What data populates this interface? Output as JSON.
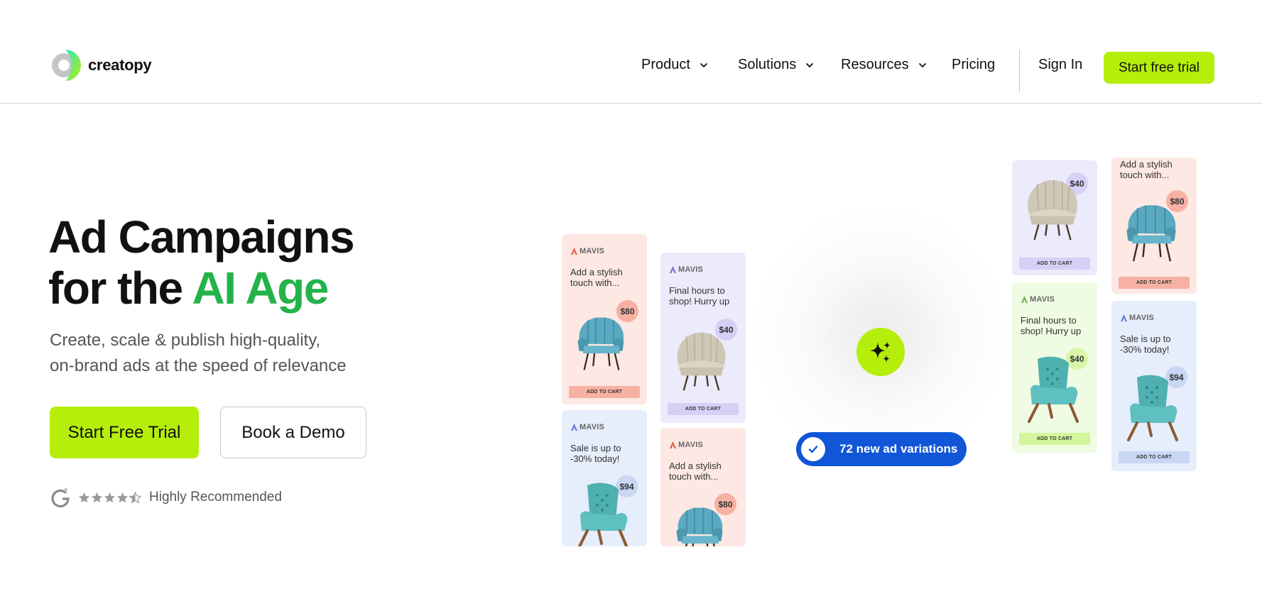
{
  "header": {
    "logo_text": "creatopy",
    "nav": [
      {
        "label": "Product",
        "has_dropdown": true
      },
      {
        "label": "Solutions",
        "has_dropdown": true
      },
      {
        "label": "Resources",
        "has_dropdown": true
      },
      {
        "label": "Pricing",
        "has_dropdown": false
      }
    ],
    "sign_in": "Sign In",
    "cta": "Start free trial"
  },
  "hero": {
    "title_line1": "Ad Campaigns",
    "title_line2_prefix": "for the ",
    "title_line2_highlight": "AI Age",
    "subtitle_line1": "Create, scale & publish high-quality,",
    "subtitle_line2": "on-brand ads at the speed of relevance",
    "primary_button": "Start Free Trial",
    "secondary_button": "Book a Demo",
    "rating": {
      "stars": 4.5,
      "max": 5,
      "label": "Highly Recommended",
      "badge_icon": "g2-icon"
    }
  },
  "graphic": {
    "pill_text": "72 new ad variations",
    "center_icon": "sparkles-icon",
    "cards": [
      {
        "brand": "MAVIS",
        "headline": "Add a stylish touch with...",
        "price": "$80",
        "cta": "ADD TO CART",
        "theme": "pink",
        "chair": "teal-shell-chair"
      },
      {
        "brand": "MAVIS",
        "headline": "Final hours to shop! Hurry up",
        "price": "$40",
        "cta": "ADD TO CART",
        "theme": "lavender",
        "chair": "beige-tub-chair"
      },
      {
        "brand": "MAVIS",
        "headline": "Sale is up to -30% today!",
        "price": "$94",
        "cta": "",
        "theme": "blue",
        "chair": "teal-lounge-chair"
      },
      {
        "brand": "MAVIS",
        "headline": "Add a stylish touch with...",
        "price": "$80",
        "cta": "",
        "theme": "pink",
        "chair": "teal-shell-chair"
      },
      {
        "brand": "",
        "headline": "",
        "price": "$40",
        "cta": "ADD TO CART",
        "theme": "lavender",
        "chair": "beige-tub-chair"
      },
      {
        "brand": "",
        "headline": "Add a stylish touch with...",
        "price": "$80",
        "cta": "ADD TO CART",
        "theme": "pink",
        "chair": "teal-shell-chair"
      },
      {
        "brand": "MAVIS",
        "headline": "Final hours to shop! Hurry up",
        "price": "$40",
        "cta": "ADD TO CART",
        "theme": "mint",
        "chair": "teal-lounge-chair"
      },
      {
        "brand": "MAVIS",
        "headline": "Sale is up to -30% today!",
        "price": "$94",
        "cta": "ADD TO CART",
        "theme": "blue",
        "chair": "teal-lounge-chair"
      }
    ]
  },
  "colors": {
    "accent": "#b6ee0c",
    "highlight_green": "#23b34a",
    "pill_blue": "#1156d6"
  }
}
